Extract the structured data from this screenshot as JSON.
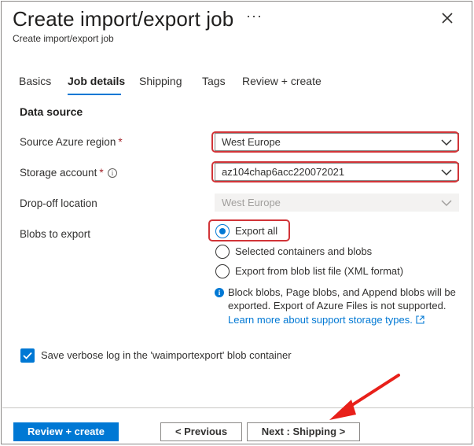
{
  "header": {
    "title": "Create import/export job",
    "subtitle": "Create import/export job",
    "more_label": "···",
    "close_icon": "close-icon"
  },
  "tabs": [
    {
      "label": "Basics"
    },
    {
      "label": "Job details",
      "active": true
    },
    {
      "label": "Shipping"
    },
    {
      "label": "Tags"
    },
    {
      "label": "Review + create"
    }
  ],
  "section": {
    "title": "Data source"
  },
  "fields": {
    "source_region": {
      "label": "Source Azure region",
      "required_mark": "*",
      "value": "West Europe"
    },
    "storage_account": {
      "label": "Storage account",
      "required_mark": "*",
      "info_icon": "info-icon",
      "value": "az104chap6acc220072021"
    },
    "dropoff": {
      "label": "Drop-off location",
      "value": "West Europe"
    },
    "blobs": {
      "label": "Blobs to export",
      "options": [
        {
          "label": "Export all",
          "selected": true
        },
        {
          "label": "Selected containers and blobs",
          "selected": false
        },
        {
          "label": "Export from blob list file (XML format)",
          "selected": false
        }
      ]
    }
  },
  "info_box": {
    "line1": "Block blobs, Page blobs, and Append blobs will be",
    "line2": "exported. Export of Azure Files is not supported.",
    "link": "Learn more about support storage types."
  },
  "verbose_log": {
    "label": "Save verbose log in the 'waimportexport' blob container",
    "checked": true
  },
  "footer": {
    "review_create": "Review + create",
    "previous": "< Previous",
    "next": "Next : Shipping >"
  },
  "colors": {
    "accent": "#0078d4",
    "highlight": "#d13438",
    "required": "#a4262c"
  }
}
